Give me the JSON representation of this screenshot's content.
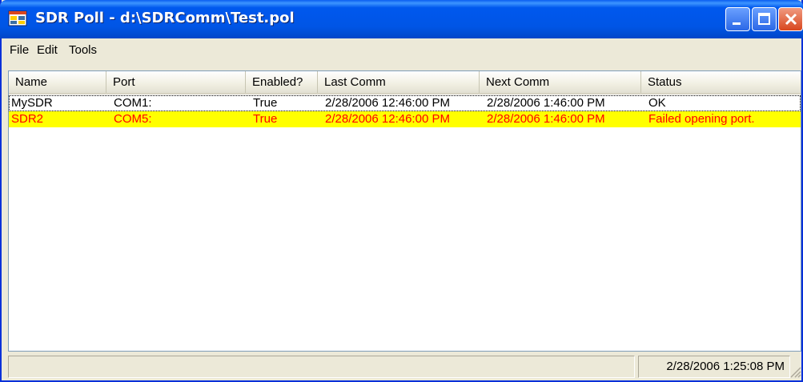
{
  "window": {
    "title": "SDR Poll - d:\\SDRComm\\Test.pol",
    "icon": "app-window-icon",
    "controls": [
      "minimize-icon",
      "maximize-icon",
      "close-icon"
    ]
  },
  "menu": {
    "file": "File",
    "edit": "Edit",
    "tools": "Tools"
  },
  "list": {
    "columns": [
      "Name",
      "Port",
      "Enabled?",
      "Last Comm",
      "Next Comm",
      "Status"
    ],
    "rows": [
      {
        "name": "MySDR",
        "port": "COM1:",
        "enabled": "True",
        "last_comm": "2/28/2006 12:46:00 PM",
        "next_comm": "2/28/2006 1:46:00 PM",
        "status": "OK",
        "highlight": ""
      },
      {
        "name": "SDR2",
        "port": "COM5:",
        "enabled": "True",
        "last_comm": "2/28/2006 12:46:00 PM",
        "next_comm": "2/28/2006 1:46:00 PM",
        "status": "Failed opening port.",
        "highlight": "#ffff00"
      }
    ]
  },
  "statusbar": {
    "left_text": "",
    "clock": "2/28/2006 1:25:08 PM"
  },
  "colors": {
    "title_bar": "#0055e5",
    "error_row_bg": "#ffff00",
    "error_row_text": "#ff0000"
  }
}
